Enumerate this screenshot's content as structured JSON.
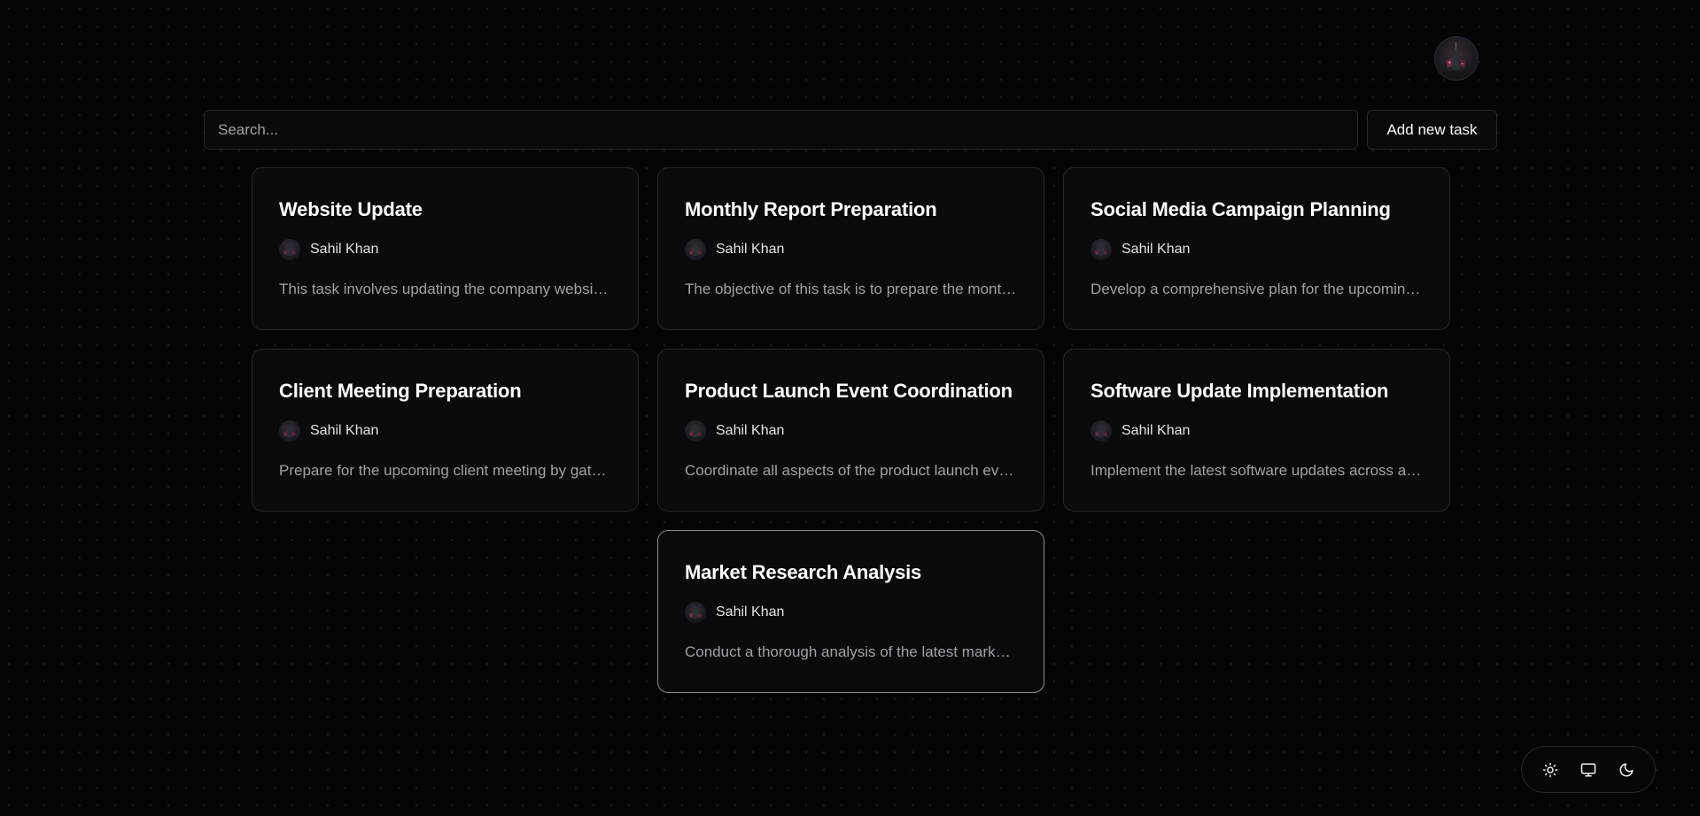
{
  "header": {
    "avatar_icon": "user-avatar"
  },
  "toolbar": {
    "search_placeholder": "Search...",
    "search_value": "",
    "add_label": "Add new task"
  },
  "tasks": [
    {
      "title": "Website Update",
      "author": "Sahil Khan",
      "description": "This task involves updating the company website with new content"
    },
    {
      "title": "Monthly Report Preparation",
      "author": "Sahil Khan",
      "description": "The objective of this task is to prepare the monthly report"
    },
    {
      "title": "Social Media Campaign Planning",
      "author": "Sahil Khan",
      "description": "Develop a comprehensive plan for the upcoming social media campaign"
    },
    {
      "title": "Client Meeting Preparation",
      "author": "Sahil Khan",
      "description": "Prepare for the upcoming client meeting by gathering materials"
    },
    {
      "title": "Product Launch Event Coordination",
      "author": "Sahil Khan",
      "description": "Coordinate all aspects of the product launch event"
    },
    {
      "title": "Software Update Implementation",
      "author": "Sahil Khan",
      "description": "Implement the latest software updates across all systems"
    },
    {
      "title": "Market Research Analysis",
      "author": "Sahil Khan",
      "description": "Conduct a thorough analysis of the latest market trends"
    }
  ],
  "theme_switch": {
    "options": [
      "sun-icon",
      "monitor-icon",
      "moon-icon"
    ]
  }
}
